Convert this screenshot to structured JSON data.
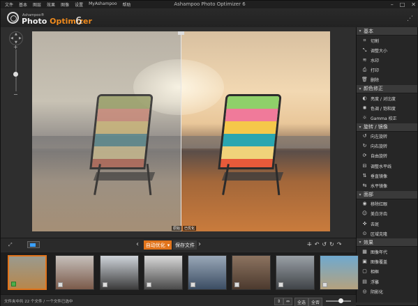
{
  "window": {
    "title": "Ashampoo Photo Optimizer 6"
  },
  "menu": [
    "文件",
    "基本",
    "图层",
    "效果",
    "图像",
    "设置",
    "MyAshampoo",
    "帮助"
  ],
  "branding": {
    "company": "Ashampoo®",
    "product_part1": "Photo ",
    "product_part2": "Optimizer",
    "version": "6"
  },
  "preview": {
    "before_label": "原始",
    "after_label": "已优化"
  },
  "right_panel": {
    "sections": [
      {
        "title": "基本",
        "items": [
          {
            "icon": "crop-icon",
            "glyph": "⌗",
            "label": "切割"
          },
          {
            "icon": "resize-icon",
            "glyph": "⤡",
            "label": "调整大小"
          },
          {
            "icon": "watermark-icon",
            "glyph": "≋",
            "label": "水印"
          },
          {
            "icon": "print-icon",
            "glyph": "⎙",
            "label": "打印"
          },
          {
            "icon": "trash-icon",
            "glyph": "🗑",
            "label": "删除"
          }
        ]
      },
      {
        "title": "颜色修正",
        "items": [
          {
            "icon": "brightness-contrast-icon",
            "glyph": "◐",
            "label": "亮度 / 对比度"
          },
          {
            "icon": "hue-saturation-icon",
            "glyph": "✺",
            "label": "色调 / 饱和度"
          },
          {
            "icon": "gamma-icon",
            "glyph": "☼",
            "label": "Gamma 校正"
          }
        ]
      },
      {
        "title": "旋转 / 镜像",
        "items": [
          {
            "icon": "rotate-left-icon",
            "glyph": "↺",
            "label": "向左旋转"
          },
          {
            "icon": "rotate-right-icon",
            "glyph": "↻",
            "label": "向右旋转"
          },
          {
            "icon": "free-rotate-icon",
            "glyph": "⟳",
            "label": "自由旋转"
          },
          {
            "icon": "straighten-icon",
            "glyph": "⊟",
            "label": "调整水平线"
          },
          {
            "icon": "flip-vertical-icon",
            "glyph": "⇅",
            "label": "垂直镜像"
          },
          {
            "icon": "flip-horizontal-icon",
            "glyph": "⇆",
            "label": "水平镜像"
          }
        ]
      },
      {
        "title": "面部",
        "items": [
          {
            "icon": "red-eye-icon",
            "glyph": "◉",
            "label": "移除红眼"
          },
          {
            "icon": "teeth-whiten-icon",
            "glyph": "☺",
            "label": "美白牙齿"
          },
          {
            "icon": "blemish-icon",
            "glyph": "✜",
            "label": "去斑"
          },
          {
            "icon": "clone-icon",
            "glyph": "⊙",
            "label": "区域克隆"
          }
        ]
      },
      {
        "title": "效果",
        "items": [
          {
            "icon": "image-era-icon",
            "glyph": "▦",
            "label": "图像年代"
          },
          {
            "icon": "image-overlay-icon",
            "glyph": "▣",
            "label": "图像覆盖"
          },
          {
            "icon": "frame-icon",
            "glyph": "▢",
            "label": "相框"
          },
          {
            "icon": "emboss-icon",
            "glyph": "▤",
            "label": "浮雕"
          },
          {
            "icon": "vignette-icon",
            "glyph": "◎",
            "label": "阴影化"
          }
        ]
      }
    ]
  },
  "bottombar": {
    "auto_optimize": "自动优化",
    "save_file": "保存文件"
  },
  "filmstrip": {
    "thumbs": [
      {
        "bg": "linear-gradient(#9a9a8e,#b7874c)"
      },
      {
        "bg": "linear-gradient(#c6c0bb,#7b5a4a)"
      },
      {
        "bg": "linear-gradient(#cfd4da,#3c3c3c)"
      },
      {
        "bg": "linear-gradient(#d8d8d8,#4a4a4a)"
      },
      {
        "bg": "linear-gradient(#9aa8b8,#3b4d63)"
      },
      {
        "bg": "linear-gradient(#8c7360,#4c3a2e)"
      },
      {
        "bg": "linear-gradient(#9aa0a6,#404448)"
      },
      {
        "bg": "linear-gradient(#6fa9cf,#b5a27e)"
      }
    ]
  },
  "statusbar": {
    "text": "文件夹中共 22 个文件 / 一个文件已选中",
    "select_all": "全选",
    "select_none": "全否"
  }
}
